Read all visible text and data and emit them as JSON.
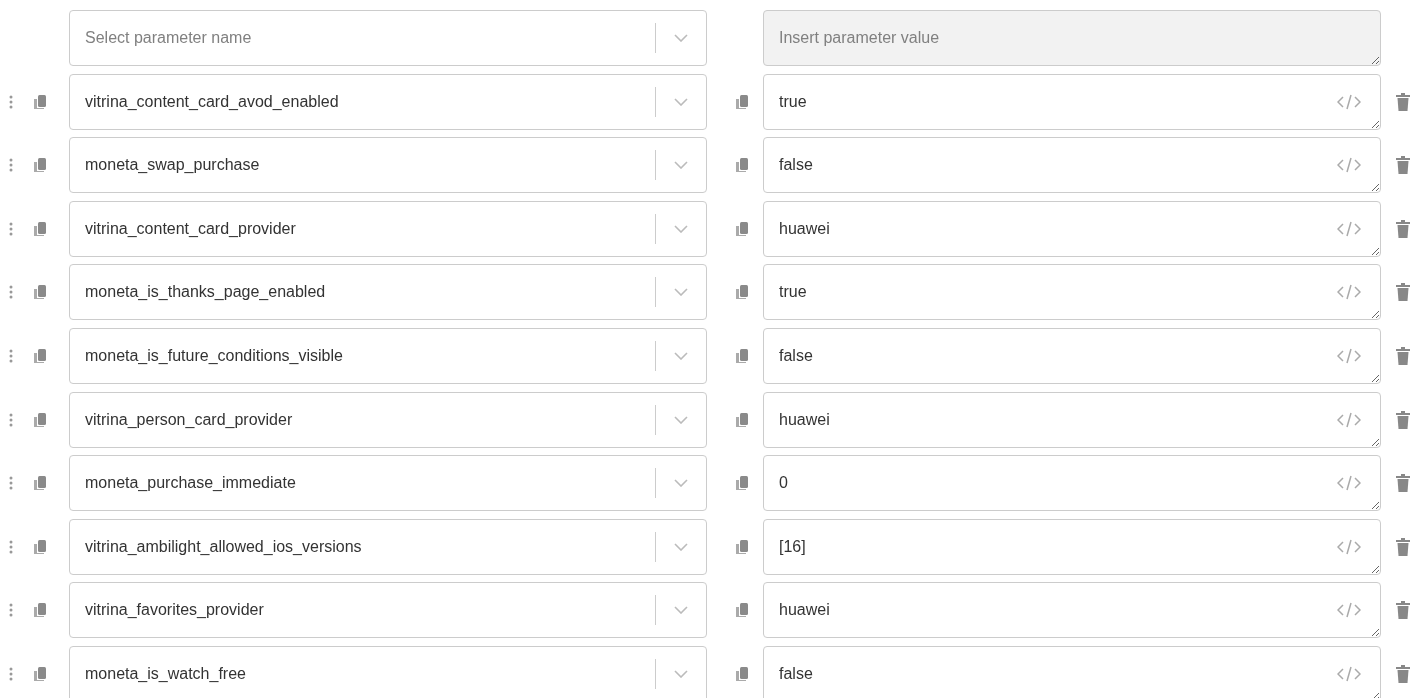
{
  "new_parameter": {
    "name_placeholder": "Select parameter name",
    "value_placeholder": "Insert parameter value",
    "value_disabled": true
  },
  "parameters": [
    {
      "name": "vitrina_content_card_avod_enabled",
      "value": "true"
    },
    {
      "name": "moneta_swap_purchase",
      "value": "false"
    },
    {
      "name": "vitrina_content_card_provider",
      "value": "huawei"
    },
    {
      "name": "moneta_is_thanks_page_enabled",
      "value": "true"
    },
    {
      "name": "moneta_is_future_conditions_visible",
      "value": "false"
    },
    {
      "name": "vitrina_person_card_provider",
      "value": "huawei"
    },
    {
      "name": "moneta_purchase_immediate",
      "value": "0"
    },
    {
      "name": "vitrina_ambilight_allowed_ios_versions",
      "value": "[16]"
    },
    {
      "name": "vitrina_favorites_provider",
      "value": "huawei"
    },
    {
      "name": "moneta_is_watch_free",
      "value": "false"
    }
  ]
}
